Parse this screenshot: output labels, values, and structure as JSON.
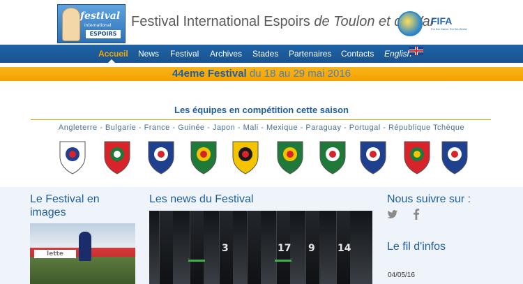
{
  "header": {
    "logo_script": "festival",
    "logo_sub": "international",
    "logo_espoirs": "ESPOIRS",
    "title_main": "Festival International Espoirs ",
    "title_italic": "de Toulon et du Var",
    "fifa": "FIFA",
    "fifa_tagline": "For the Game. For the World."
  },
  "nav": {
    "items": [
      {
        "label": "Accueil",
        "active": true
      },
      {
        "label": "News"
      },
      {
        "label": "Festival"
      },
      {
        "label": "Archives"
      },
      {
        "label": "Stades"
      },
      {
        "label": "Partenaires"
      },
      {
        "label": "Contacts"
      },
      {
        "label": "English"
      }
    ]
  },
  "banner": {
    "bold": "44eme Festival",
    "normal": " du 18 au 29 mai 2016"
  },
  "teams": {
    "title": "Les équipes en compétition cette saison",
    "list": "Angleterre - Bulgarie - France - Guinée - Japon - Mali - Mexique - Paraguay - Portugal - République Tchèque",
    "crests": [
      {
        "name": "england",
        "primary": "#ffffff",
        "secondary": "#1f3f8f",
        "accent": "#d8232a"
      },
      {
        "name": "bulgaria",
        "primary": "#d8232a",
        "secondary": "#1f7a3a",
        "accent": "#ffffff"
      },
      {
        "name": "france",
        "primary": "#1f3f8f",
        "secondary": "#ffffff",
        "accent": "#d8232a"
      },
      {
        "name": "guinea",
        "primary": "#1f7a3a",
        "secondary": "#f4c400",
        "accent": "#d8232a"
      },
      {
        "name": "japan",
        "primary": "#f4c400",
        "secondary": "#1a1a1a",
        "accent": "#d8232a"
      },
      {
        "name": "mali",
        "primary": "#1f7a3a",
        "secondary": "#f4c400",
        "accent": "#d8232a"
      },
      {
        "name": "mexico",
        "primary": "#1f7a3a",
        "secondary": "#ffffff",
        "accent": "#d8232a"
      },
      {
        "name": "paraguay",
        "primary": "#1f3f8f",
        "secondary": "#ffffff",
        "accent": "#d8232a"
      },
      {
        "name": "portugal",
        "primary": "#d8232a",
        "secondary": "#1f7a3a",
        "accent": "#f4c400"
      },
      {
        "name": "czech-republic",
        "primary": "#1f3f8f",
        "secondary": "#ffffff",
        "accent": "#d8232a"
      }
    ]
  },
  "lower": {
    "festival_title": "Le Festival en images",
    "news_title": "Les news du Festival",
    "follow_title": "Nous suivre sur :",
    "feed_title": "Le fil d'infos",
    "date": "04/05/16",
    "ad_text": "lette",
    "news_numbers": [
      "3",
      "17",
      "9",
      "14"
    ]
  },
  "colors": {
    "nav": "#1a5390",
    "accent": "#f4a000",
    "title_blue": "#1f5e9e"
  }
}
